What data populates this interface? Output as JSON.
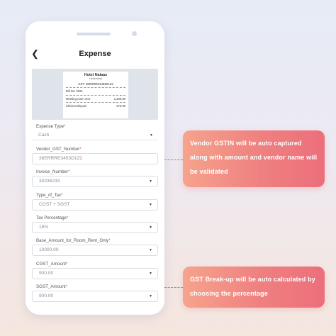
{
  "screen": {
    "title": "Expense"
  },
  "receipt": {
    "shop_name": "Hotel Nalaas",
    "city": "Hyderabad",
    "gst_line": "GST: 36ERRRE3453D1Z2",
    "bill_no": "Bill No: 0921",
    "items": [
      {
        "name": "Meeting room rent",
        "amount": "1,200.00"
      },
      {
        "name": "Chicken Biryani",
        "amount": "270.00"
      }
    ]
  },
  "form": {
    "fields": [
      {
        "label": "Expense Type",
        "value": "Cash"
      },
      {
        "label": "Vendor_GST_Number",
        "value": "36ERRRE3453D1Z2"
      },
      {
        "label": "Invoice_Number",
        "value": "34236233"
      },
      {
        "label": "Type_of_Tax",
        "value": "CGST + SGST"
      },
      {
        "label": "Tax Percentage",
        "value": "18%"
      },
      {
        "label": "Base_Amount_for_Room_Rent_Only",
        "value": "10000.00"
      },
      {
        "label": "CGST_Amount",
        "value": "900.00"
      },
      {
        "label": "SGST_Amount",
        "value": "900.00"
      }
    ],
    "required_mark": "*",
    "caret": "▼"
  },
  "callouts": {
    "gstin": "Vendor GSTIN will be auto captured along with amount and vendor name will be validated",
    "breakup": "GST Break-up will be auto calculated by choosing the percentage"
  },
  "icons": {
    "back": "chevron-left-icon",
    "dropdown": "chevron-down-icon"
  },
  "colors": {
    "callout_start": "#f6a38c",
    "callout_end": "#ec6f7b",
    "required": "#e0474c"
  }
}
